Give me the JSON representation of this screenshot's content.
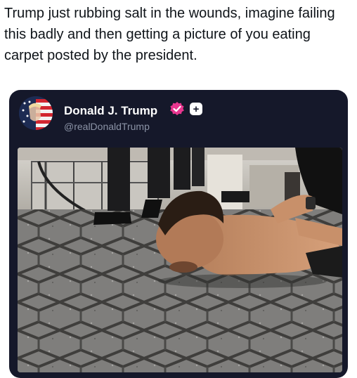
{
  "caption": "Trump just rubbing salt in the wounds, imagine failing this badly and then getting a picture of you eating carpet posted by the president.",
  "post": {
    "display_name": "Donald J. Trump",
    "handle": "@realDonaldTrump",
    "verified_icon": "verified-badge-icon",
    "follow_label": "+"
  },
  "colors": {
    "card_background": "#15182a",
    "verified_badge": "#e8368f"
  }
}
